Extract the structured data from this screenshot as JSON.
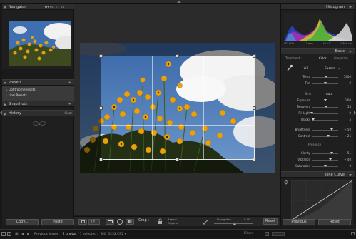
{
  "left_panel": {
    "navigator": {
      "title": "Navigator",
      "zoom_options": [
        "FIT",
        "FILL",
        "1:1",
        "4:1"
      ]
    },
    "presets": {
      "title": "Presets",
      "items": [
        "Lightroom Presets",
        "User Presets"
      ]
    },
    "snapshots": {
      "title": "Snapshots"
    },
    "history": {
      "title": "History",
      "clear": "Clear"
    },
    "copy_label": "Copy...",
    "paste_label": "Paste"
  },
  "toolbar": {
    "crop_label": "Crop :",
    "aspect_label": "Aspect :",
    "aspect_value": "Original",
    "straighten_label": "Straighten",
    "straighten_value": "0.00",
    "reset_label": "Reset"
  },
  "right_panel": {
    "histogram": {
      "title": "Histogram",
      "info": [
        "ISO 800",
        "13 mm",
        "f / 11",
        "1/400 sec"
      ]
    },
    "basic": {
      "title": "Basic",
      "treatment_label": "Treatment :",
      "treatment_color": "Color",
      "treatment_gray": "Grayscale",
      "wb_label": "WB :",
      "wb_value": "Custom",
      "sliders_wb": [
        {
          "label": "Temp",
          "value": "5600",
          "pos": 0.55
        },
        {
          "label": "Tint",
          "value": "+ 2",
          "pos": 0.52
        }
      ],
      "tone_label": "Tone",
      "tone_auto": "Auto",
      "sliders_tone": [
        {
          "label": "Exposure",
          "value": "0.00",
          "pos": 0.5
        },
        {
          "label": "Recovery",
          "value": "54",
          "pos": 0.54
        },
        {
          "label": "Fill Light",
          "value": "0",
          "pos": 0.0
        },
        {
          "label": "Blacks",
          "value": "5",
          "pos": 0.05
        }
      ],
      "sliders_bc": [
        {
          "label": "Brightness",
          "value": "+ 50",
          "pos": 0.75
        },
        {
          "label": "Contrast",
          "value": "+ 25",
          "pos": 0.62
        }
      ],
      "presence_label": "Presence",
      "sliders_presence": [
        {
          "label": "Clarity",
          "value": "51",
          "pos": 0.75
        },
        {
          "label": "Vibrance",
          "value": "+ 40",
          "pos": 0.7
        },
        {
          "label": "Saturation",
          "value": "0",
          "pos": 0.5
        }
      ]
    },
    "tone_curve": {
      "title": "Tone Curve"
    },
    "previous_label": "Previous",
    "reset_label": "Reset"
  },
  "filmstrip": {
    "page1": "1",
    "page2": "2",
    "source": "Previous Import",
    "count": "2 photos",
    "selected": "/ 1 selected /",
    "filename": "_MG_0232.CR2",
    "filters_label": "Filters :"
  }
}
